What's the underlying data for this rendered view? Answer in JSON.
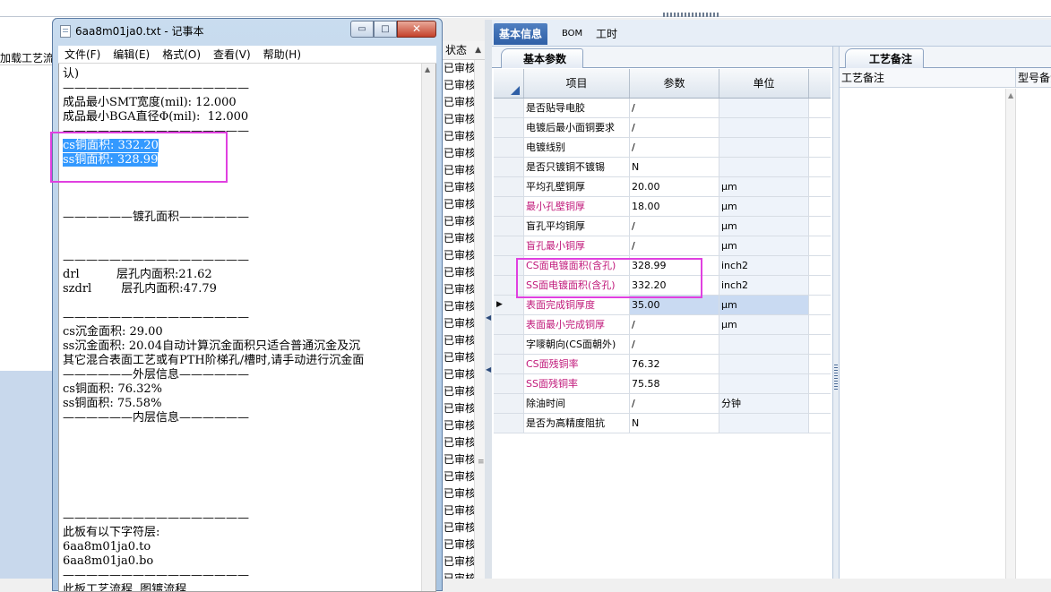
{
  "left_app": {
    "tab_label": "加载工艺流程",
    "status_header": "状态",
    "status_values": [
      "已审核",
      "已审核",
      "已审核",
      "已审核",
      "已审核",
      "已审核",
      "已审核",
      "已审核",
      "已审核",
      "已审核",
      "已审核",
      "已审核",
      "已审核",
      "已审核",
      "已审核",
      "已审核",
      "已审核",
      "已审核",
      "已审核",
      "已审核",
      "已审核",
      "已审核",
      "已审核",
      "已审核",
      "已审核",
      "已审核",
      "已审核",
      "已审核",
      "已审核",
      "已审核",
      "已审核"
    ]
  },
  "notepad": {
    "title": "6aa8m01ja0.txt - 记事本",
    "buttons": {
      "minimize": "▭",
      "maximize": "□",
      "close": "✕"
    },
    "menu": [
      "文件(F)",
      "编辑(E)",
      "格式(O)",
      "查看(V)",
      "帮助(H)"
    ],
    "lines": [
      "认)",
      "————————————————",
      "成品最小SMT宽度(mil): 12.000",
      "成品最小BGA直径Φ(mil):  12.000",
      "————————————————",
      "cs铜面积: 332.20",
      "ss铜面积: 328.99",
      "",
      "",
      "",
      "——————镀孔面积——————",
      "",
      "",
      "————————————————",
      "drl          层孔内面积:21.62",
      "szdrl        层孔内面积:47.79",
      "",
      "————————————————",
      "cs沉金面积: 29.00",
      "ss沉金面积: 20.04自动计算沉金面积只适合普通沉金及沉",
      "其它混合表面工艺或有PTH阶梯孔/槽时,请手动进行沉金面",
      "——————外层信息——————",
      "cs铜面积: 76.32%",
      "ss铜面积: 75.58%",
      "——————内层信息——————",
      "",
      "",
      "",
      "",
      "",
      "",
      "————————————————",
      "此板有以下字符层:",
      "6aa8m01ja0.to",
      "6aa8m01ja0.bo",
      "————————————————",
      "此板工艺流程, 图镀流程"
    ]
  },
  "erp": {
    "tabs": [
      "基本信息",
      "BOM",
      "工时"
    ],
    "subtab": "基本参数",
    "columns": [
      "项目",
      "参数",
      "单位"
    ],
    "rows": [
      {
        "item": "是否贴导电胶",
        "value": "/",
        "unit": "",
        "red": false
      },
      {
        "item": "电镀后最小面铜要求",
        "value": "/",
        "unit": "",
        "red": false
      },
      {
        "item": "电镀线别",
        "value": "/",
        "unit": "",
        "red": false
      },
      {
        "item": "是否只镀铜不镀锡",
        "value": "N",
        "unit": "",
        "red": false
      },
      {
        "item": "平均孔壁铜厚",
        "value": "20.00",
        "unit": "μm",
        "red": false
      },
      {
        "item": "最小孔壁铜厚",
        "value": "18.00",
        "unit": "μm",
        "red": true
      },
      {
        "item": "盲孔平均铜厚",
        "value": "/",
        "unit": "μm",
        "red": false
      },
      {
        "item": "盲孔最小铜厚",
        "value": "/",
        "unit": "μm",
        "red": true
      },
      {
        "item": "CS面电镀面积(含孔)",
        "value": "328.99",
        "unit": "inch2",
        "red": true
      },
      {
        "item": "SS面电镀面积(含孔)",
        "value": "332.20",
        "unit": "inch2",
        "red": true
      },
      {
        "item": "表面完成铜厚度",
        "value": "35.00",
        "unit": "μm",
        "red": true,
        "current": true
      },
      {
        "item": "表面最小完成铜厚",
        "value": "/",
        "unit": "μm",
        "red": true
      },
      {
        "item": "字嘜朝向(CS面朝外)",
        "value": "/",
        "unit": "",
        "red": false
      },
      {
        "item": "CS面残铜率",
        "value": "76.32",
        "unit": "",
        "red": true
      },
      {
        "item": "SS面残铜率",
        "value": "75.58",
        "unit": "",
        "red": true
      },
      {
        "item": "除油时间",
        "value": "/",
        "unit": "分钟",
        "red": false
      },
      {
        "item": "是否为高精度阻抗",
        "value": "N",
        "unit": "",
        "red": false
      }
    ],
    "remark_tab": "工艺备注",
    "remark_columns": [
      "工艺备注",
      "型号备注"
    ]
  }
}
